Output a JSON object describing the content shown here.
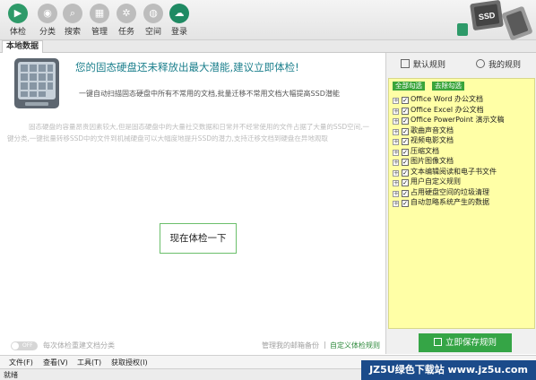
{
  "toolbar": {
    "items": [
      {
        "label": "体检",
        "icon": "health-check-icon",
        "glyph": "▶",
        "active": true
      },
      {
        "label": "分类",
        "icon": "location-pin-icon",
        "glyph": "◉"
      },
      {
        "label": "搜索",
        "icon": "search-icon",
        "glyph": "⌕"
      },
      {
        "label": "管理",
        "icon": "grid-icon",
        "glyph": "▦"
      },
      {
        "label": "任务",
        "icon": "gear-icon",
        "glyph": "✲"
      },
      {
        "label": "空间",
        "icon": "space-icon",
        "glyph": "◍"
      },
      {
        "label": "登录",
        "icon": "cloud-icon",
        "glyph": "☁"
      }
    ],
    "art_label": "SSD"
  },
  "tabs": {
    "current": "本地数据"
  },
  "main": {
    "headline": "您的固态硬盘还未释放出最大潜能,建议立即体检!",
    "subline": "一键自动扫描固态硬盘中所有不常用的文档,批量迁移不常用文档大幅提高SSD潜能",
    "description": "固态硬盘的容量昂贵因素较大,但是固态硬盘中的大量社交数据和日常并不经常使用的文件占据了大量的SSD空间,一键分类,一键批量转移SSD中的文件到机械硬盘可以大幅度地提升SSD的潜力,支持迁移文档到硬盘在异地观取",
    "check_button": "现在体检一下",
    "toggle_state": "OFF",
    "toggle_label": "每次体检重建文档分类",
    "manage_link": "管理我的邮箱备份",
    "separator": "|",
    "custom_link": "自定义体检规则"
  },
  "rules_panel": {
    "tab_default": "默认规则",
    "tab_mine": "我的规则",
    "select_all": "全部勾选",
    "deselect_all": "去除勾选",
    "items": [
      {
        "label": "Office Word 办公文档",
        "checked": true
      },
      {
        "label": "Office Excel 办公文档",
        "checked": true
      },
      {
        "label": "Office PowerPoint 演示文稿",
        "checked": true
      },
      {
        "label": "歌曲声音文档",
        "checked": true
      },
      {
        "label": "视频电影文档",
        "checked": true
      },
      {
        "label": "压缩文档",
        "checked": true
      },
      {
        "label": "图片图像文档",
        "checked": true
      },
      {
        "label": "文本编辑阅读和电子书文件",
        "checked": true
      },
      {
        "label": "用户自定义规则",
        "checked": true
      },
      {
        "label": "占用硬盘空间的垃圾清理",
        "checked": true
      },
      {
        "label": "自动忽略系统产生的数据",
        "checked": true
      }
    ],
    "save_button": "立即保存规则"
  },
  "menubar": {
    "file": "文件(F)",
    "view": "查看(V)",
    "tools": "工具(T)",
    "license": "获取授权(I)"
  },
  "status": {
    "text": "就绪"
  },
  "watermark": {
    "text": "JZ5U绿色下载站 www.jz5u.com"
  }
}
